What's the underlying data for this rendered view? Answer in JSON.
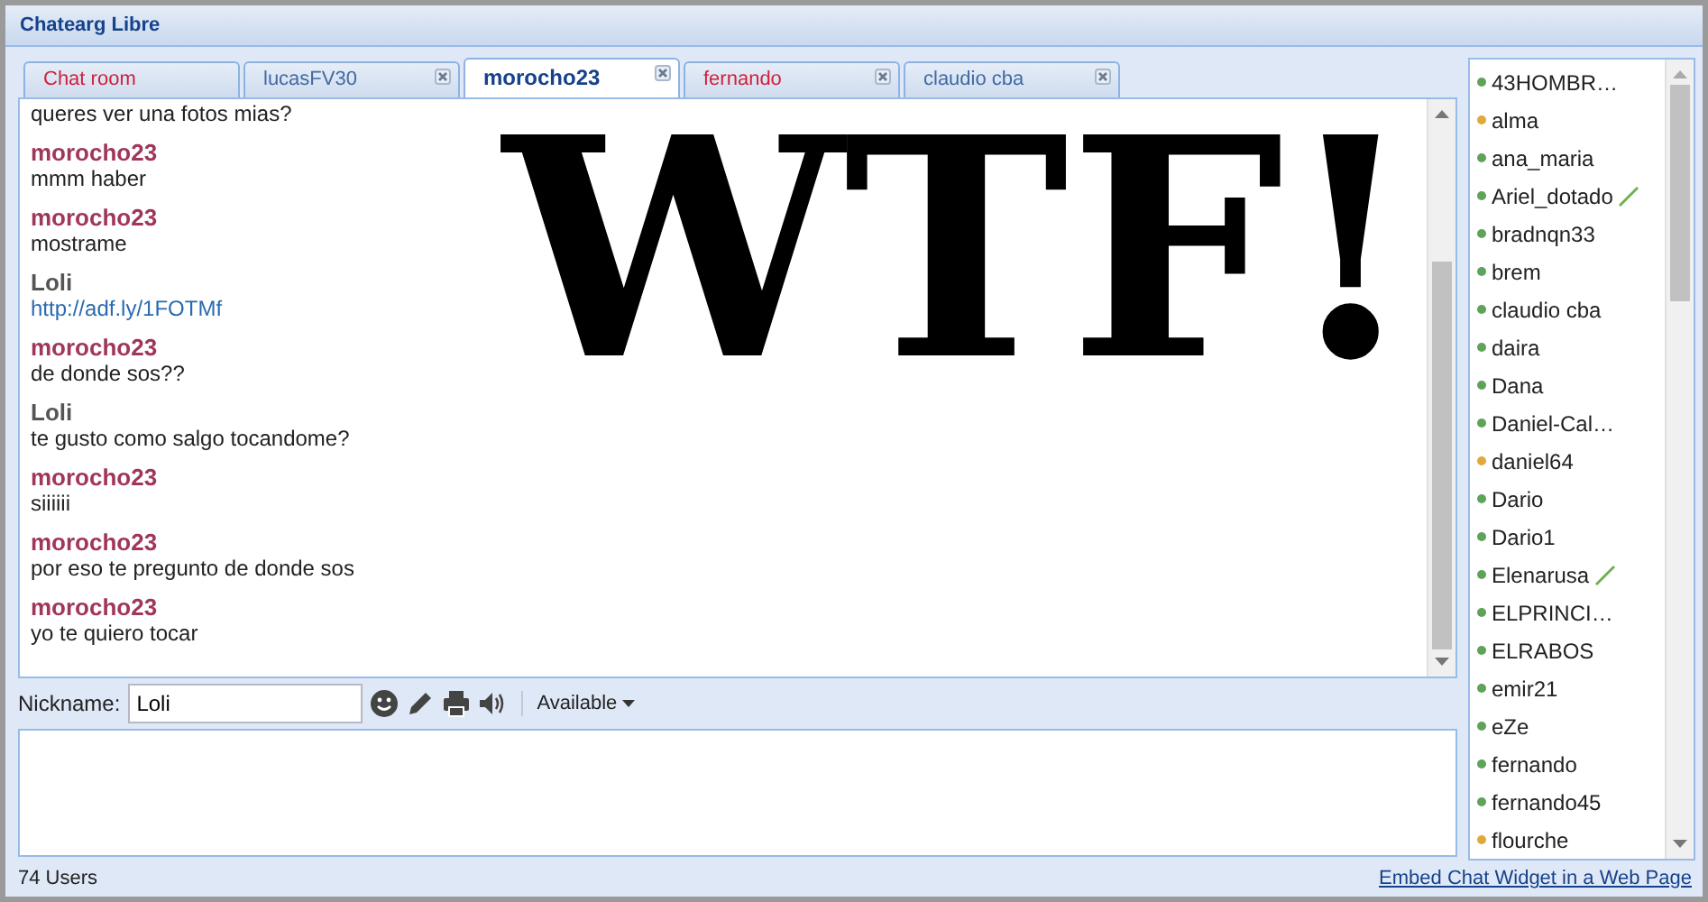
{
  "window": {
    "title": "Chatearg Libre"
  },
  "tabs": [
    {
      "label": "Chat room",
      "selected": false,
      "unread": true,
      "closable": false
    },
    {
      "label": "lucasFV30",
      "selected": false,
      "unread": false,
      "closable": true
    },
    {
      "label": "morocho23",
      "selected": true,
      "unread": false,
      "closable": true
    },
    {
      "label": "fernando",
      "selected": false,
      "unread": true,
      "closable": true
    },
    {
      "label": "claudio cba",
      "selected": false,
      "unread": false,
      "closable": true
    }
  ],
  "messages": [
    {
      "text": "queres ver una fotos mias?",
      "kind": "text"
    },
    {
      "author": "morocho23",
      "color": "#a0365a",
      "text": "mmm haber",
      "kind": "text"
    },
    {
      "author": "morocho23",
      "color": "#a0365a",
      "text": "mostrame",
      "kind": "text"
    },
    {
      "author": "Loli",
      "color": "#555555",
      "text": "http://adf.ly/1FOTMf",
      "kind": "link"
    },
    {
      "author": "morocho23",
      "color": "#a0365a",
      "text": "de donde sos??",
      "kind": "text"
    },
    {
      "author": "Loli",
      "color": "#555555",
      "text": "te gusto como salgo tocandome?",
      "kind": "text"
    },
    {
      "author": "morocho23",
      "color": "#a0365a",
      "text": "siiiiii",
      "kind": "text"
    },
    {
      "author": "morocho23",
      "color": "#a0365a",
      "text": "por eso te pregunto de donde sos",
      "kind": "text"
    },
    {
      "author": "morocho23",
      "color": "#a0365a",
      "text": "yo te quiero tocar",
      "kind": "text"
    }
  ],
  "overlay": {
    "text": "WTF!"
  },
  "toolbar": {
    "nickname_label": "Nickname:",
    "nickname": "Loli",
    "status": "Available"
  },
  "users": [
    {
      "name": "43HOMBR…",
      "color": "#5fa35a",
      "typing": false
    },
    {
      "name": "alma",
      "color": "#e0a93a",
      "typing": false
    },
    {
      "name": "ana_maria",
      "color": "#5fa35a",
      "typing": false
    },
    {
      "name": "Ariel_dotado",
      "color": "#5fa35a",
      "typing": true
    },
    {
      "name": "bradnqn33",
      "color": "#5fa35a",
      "typing": false
    },
    {
      "name": "brem",
      "color": "#5fa35a",
      "typing": false
    },
    {
      "name": "claudio cba",
      "color": "#5fa35a",
      "typing": false
    },
    {
      "name": "daira",
      "color": "#5fa35a",
      "typing": false
    },
    {
      "name": "Dana",
      "color": "#5fa35a",
      "typing": false
    },
    {
      "name": "Daniel-Cal…",
      "color": "#5fa35a",
      "typing": false
    },
    {
      "name": "daniel64",
      "color": "#e0a93a",
      "typing": false
    },
    {
      "name": "Dario",
      "color": "#5fa35a",
      "typing": false
    },
    {
      "name": "Dario1",
      "color": "#5fa35a",
      "typing": false
    },
    {
      "name": "Elenarusa",
      "color": "#5fa35a",
      "typing": true
    },
    {
      "name": "ELPRINCI…",
      "color": "#5fa35a",
      "typing": false
    },
    {
      "name": "ELRABOS",
      "color": "#5fa35a",
      "typing": false
    },
    {
      "name": "emir21",
      "color": "#5fa35a",
      "typing": false
    },
    {
      "name": "eZe",
      "color": "#5fa35a",
      "typing": false
    },
    {
      "name": "fernando",
      "color": "#5fa35a",
      "typing": false
    },
    {
      "name": "fernando45",
      "color": "#5fa35a",
      "typing": false
    },
    {
      "name": "flourche",
      "color": "#e0a93a",
      "typing": false
    }
  ],
  "status_bar": {
    "users": "74 Users",
    "link": "Embed Chat Widget in a Web Page"
  }
}
